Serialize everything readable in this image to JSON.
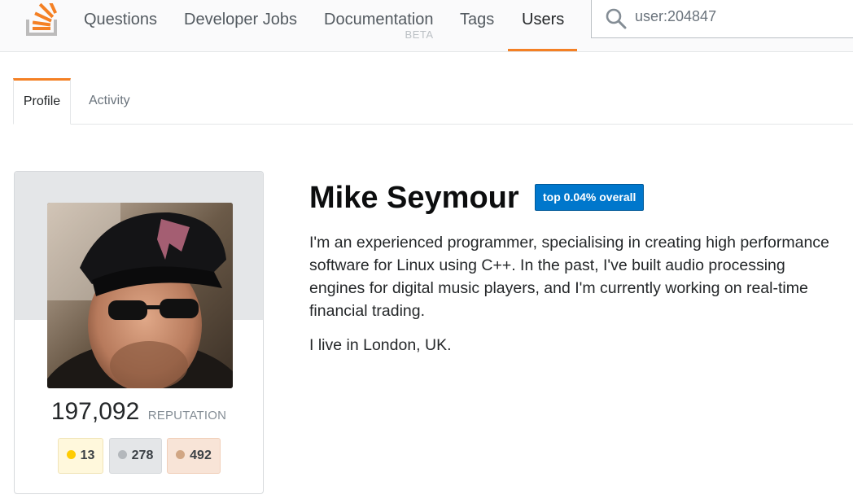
{
  "topbar": {
    "logo_icon": "stackoverflow-logo-icon",
    "nav": [
      {
        "label": "Questions",
        "active": false
      },
      {
        "label": "Developer Jobs",
        "active": false
      },
      {
        "label": "Documentation",
        "sublabel": "BETA",
        "active": false
      },
      {
        "label": "Tags",
        "active": false
      },
      {
        "label": "Users",
        "active": true
      }
    ],
    "search": {
      "icon": "search-icon",
      "value": "user:204847"
    }
  },
  "tabs": [
    {
      "label": "Profile",
      "active": true
    },
    {
      "label": "Activity",
      "active": false
    }
  ],
  "profile": {
    "avatar_icon": "user-avatar-photo",
    "reputation": "197,092",
    "reputation_label": "REPUTATION",
    "badges": {
      "gold": "13",
      "silver": "278",
      "bronze": "492"
    },
    "name": "Mike Seymour",
    "rank": "top 0.04% overall",
    "bio": [
      "I'm an experienced programmer, specialising in creating high performance software for Linux using C++. In the past, I've built audio processing engines for digital music players, and I'm currently working on real-time financial trading.",
      "I live in London, UK."
    ]
  },
  "colors": {
    "accent": "#f48024",
    "rank_badge": "#0077cc",
    "gold": "#ffcc01",
    "silver": "#b4b8bc",
    "bronze": "#d1a684"
  }
}
